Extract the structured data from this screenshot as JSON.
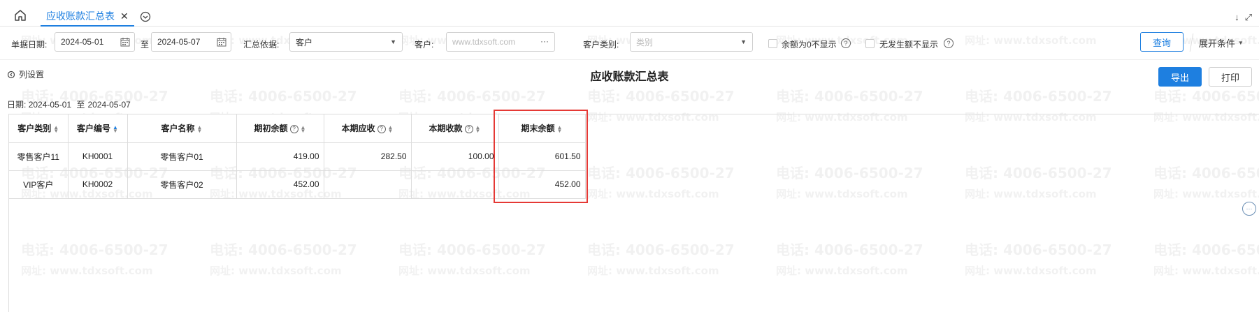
{
  "tab": {
    "label": "应收账款汇总表",
    "close": "✕"
  },
  "topright": {
    "arrow": "↓",
    "expand": "⤢"
  },
  "filters": {
    "date_label": "单据日期:",
    "date_from": "2024-05-01",
    "date_sep": "至",
    "date_to": "2024-05-07",
    "summary_label": "汇总依据:",
    "summary_value": "客户",
    "customer_label": "客户:",
    "customer_placeholder": "www.tdxsoft.com",
    "customer_more": "···",
    "category_label": "客户类别:",
    "category_placeholder": "类别",
    "zero_balance_label": "余额为0不显示",
    "no_amount_label": "无发生额不显示",
    "query_label": "查询",
    "expand_label": "展开条件"
  },
  "toolbar": {
    "column_settings": "列设置",
    "title": "应收账款汇总表",
    "export_label": "导出",
    "print_label": "打印",
    "date_prefix": "日期:",
    "date_from": "2024-05-01",
    "date_sep": "至",
    "date_to": "2024-05-07"
  },
  "table": {
    "headers": [
      "客户类别",
      "客户编号",
      "客户名称",
      "期初余额",
      "本期应收",
      "本期收款",
      "期末余额"
    ],
    "rows": [
      [
        "零售客户11",
        "KH0001",
        "零售客户01",
        "419.00",
        "282.50",
        "100.00",
        "601.50"
      ],
      [
        "VIP客户",
        "KH0002",
        "零售客户02",
        "452.00",
        "",
        "",
        "452.00"
      ]
    ]
  },
  "watermark": {
    "line1": "电话: 4006-6500-27",
    "line2": "网址: www.tdxsoft.com"
  },
  "colors": {
    "accent": "#1e7fe0",
    "highlight": "#e53935"
  }
}
